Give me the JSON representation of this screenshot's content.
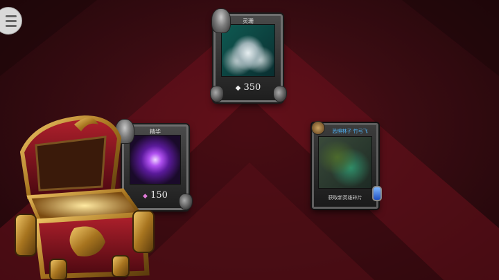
{
  "cards": {
    "coins": {
      "title": "灵珊",
      "value": "350",
      "icon": "coin-stack",
      "currency_icon": "coin-icon"
    },
    "essence": {
      "title": "精华",
      "value": "150",
      "icon": "purple-orb",
      "currency_icon": "gem-icon"
    },
    "hero": {
      "title": "恐惧林子 竹弓飞",
      "subtitle": "获取新英雄碎片"
    }
  },
  "colors": {
    "background": "#3a0c12",
    "accent_blue": "#4fb8ff",
    "card_frame": "#6e6e6e"
  }
}
